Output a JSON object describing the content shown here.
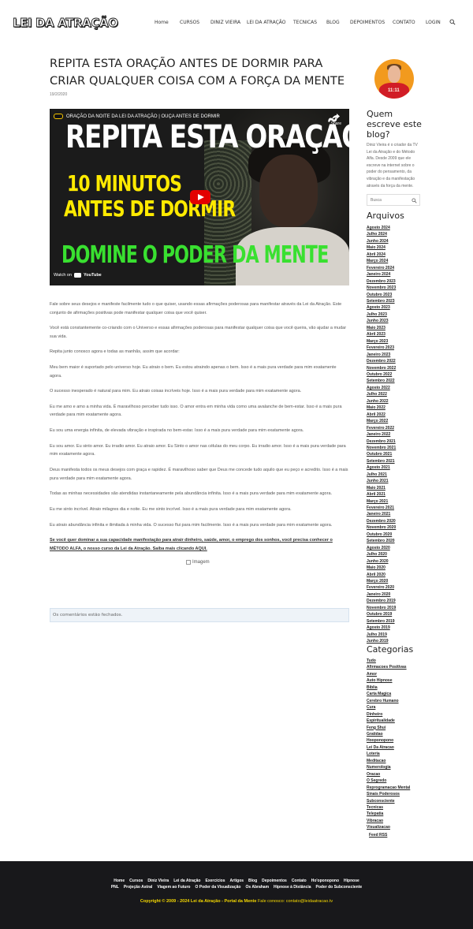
{
  "header": {
    "logo": "LEI DA ATRAÇÃO",
    "nav": [
      "Home",
      "CURSOS",
      "DINIZ VIEIRA",
      "LEI DA ATRAÇÃO",
      "TECNICAS",
      "BLOG",
      "DEPOIMENTOS",
      "CONTATO",
      "LOGIN"
    ],
    "search_icon": "search-icon"
  },
  "post": {
    "title": "REPITA ESTA ORAÇÃO ANTES DE DORMIR PARA CRIAR QUALQUER COISA COM A FORÇA DA MENTE",
    "date": "19/2/2020",
    "video": {
      "bar_title": "ORAÇÃO DA NOITE DA LEI DA ATRAÇÃO | OUÇA ANTES DE DORMIR",
      "share": "Share",
      "line1": "REPITA ESTA ORAÇÃO",
      "line2": "10 MINUTOS",
      "line3": "ANTES DE DORMIR",
      "line4": "DOMINE O PODER DA MENTE",
      "watch_on": "Watch on",
      "youtube": "YouTube"
    },
    "paragraphs": [
      "Fale sobre seus desejos e manifeste facilmente tudo o que quiser, usando essas afirmações poderosas para manifestar através da Lei da Atração. Este conjunto de afirmações positivas pode manifestar qualquer coisa que você quiser.",
      "Você está constantemente co-criando com o Universo e essas afirmações poderosas para manifestar qualquer coisa que você queira, vão ajudar a mudar sua vida.",
      "Repita junto conosco agora e todas as manhãs, assim que acordar:",
      "Meu bem maior é suportado pelo universo hoje. Eu atraio o bem. Eu estou atraindo apenas o bem. Isso é a mais pura verdade para mim exatamente agora.",
      "O sucesso inesperado é natural para mim. Eu atraio coisas incríveis hoje. Isso é a mais pura verdade para mim exatamente agora.",
      "Eu me amo e amo a minha vida. É maravilhoso perceber tudo isso. O amor entra em minha vida como uma avalanche de bem-estar. Isso é a mais pura verdade para mim exatamente agora.",
      "Eu sou uma energia infinita, de elevada vibração e inspirada no bem-estar. Isso é a mais pura verdade para mim exatamente agora.",
      "Eu sou amor. Eu sinto amor. Eu irradio amor. Eu atraio amor. Eu Sinto o amor nas células do meu corpo. Eu irradio amor. Isso é a mais pura verdade para mim exatamente agora.",
      "Deus manifesta todos os meus desejos com graça e rapidez. É maravilhoso saber que Deus me concede tudo aquilo que eu peço e acredito. Isso é a mais pura verdade para mim exatamente agora.",
      "Todas as minhas necessidades são atendidas instantaneamente pela abundância infinita. Isso é a mais pura verdade para mim exatamente agora.",
      "Eu me sinto incrível. Atraio milagres dia e noite. Eu me sinto incrível. Isso é a mais pura verdade para mim exatamente agora.",
      "Eu atraio abundância infinita e ilimitada à minha vida. O sucesso flui para mim facilmente. Isso é a mais pura verdade para mim exatamente agora."
    ],
    "cta": "Se você quer dominar a sua capacidade manifestação para atrair dinheiro, saúde, amor, o emprego dos sonhos, você precisa conhecer o MÉTODO ALFA, o nosso curso da Lei da Atração. Saiba mais clicando AQUI.",
    "image_alt": "Imagem",
    "comments_closed": "Os comentários estão fechados."
  },
  "sidebar": {
    "who_title": "Quem escreve este blog?",
    "who_text": "Diniz Vieira é o criador da TV Lei da Atração e do Método Alfa. Desde 2009 que ele escreve na internet sobre o poder do pensamento, da vibração e da manifestação através da força da mente.",
    "avatar_number": "11:11",
    "search_placeholder": "Busca",
    "archives_title": "Arquivos",
    "archives": [
      "Agosto 2024",
      "Julho 2024",
      "Junho 2024",
      "Maio 2024",
      "Abril 2024",
      "Março 2024",
      "Fevereiro 2024",
      "Janeiro 2024",
      "Dezembro 2023",
      "Novembro 2023",
      "Outubro 2023",
      "Setembro 2023",
      "Agosto 2023",
      "Julho 2023",
      "Junho 2023",
      "Maio 2023",
      "Abril 2023",
      "Março 2023",
      "Fevereiro 2023",
      "Janeiro 2023",
      "Dezembro 2022",
      "Novembro 2022",
      "Outubro 2022",
      "Setembro 2022",
      "Agosto 2022",
      "Julho 2022",
      "Junho 2022",
      "Maio 2022",
      "Abril 2022",
      "Março 2022",
      "Fevereiro 2022",
      "Janeiro 2022",
      "Dezembro 2021",
      "Novembro 2021",
      "Outubro 2021",
      "Setembro 2021",
      "Agosto 2021",
      "Julho 2021",
      "Junho 2021",
      "Maio 2021",
      "Abril 2021",
      "Março 2021",
      "Fevereiro 2021",
      "Janeiro 2021",
      "Dezembro 2020",
      "Novembro 2020",
      "Outubro 2020",
      "Setembro 2020",
      "Agosto 2020",
      "Julho 2020",
      "Junho 2020",
      "Maio 2020",
      "Abril 2020",
      "Março 2020",
      "Fevereiro 2020",
      "Janeiro 2020",
      "Dezembro 2019",
      "Novembro 2019",
      "Outubro 2019",
      "Setembro 2019",
      "Agosto 2019",
      "Julho 2019",
      "Junho 2019"
    ],
    "categories_title": "Categorias",
    "categories": [
      "Tudo",
      "Afirmacoes Positivas",
      "Amor",
      "Auto Hipnose",
      "Biblia",
      "Carta Magica",
      "Cerebro Humano",
      "Cura",
      "Dinheiro",
      "Espiritualidade",
      "Feng Shui",
      "Gratidao",
      "Hooponopono",
      "Lei Da Atracao",
      "Loteria",
      "Meditacao",
      "Numerologia",
      "Oracao",
      "O Segredo",
      "Reprogramacao Mental",
      "Sinais Poderosos",
      "Subconsciente",
      "Tecnicas",
      "Telepatia",
      "Vibracao",
      "Visualizacao"
    ],
    "feed": "Feed RSS"
  },
  "footer": {
    "row1": [
      "Home",
      "Cursos",
      "Diniz Vieira",
      "Lei da Atração",
      "Exercícios",
      "Artigos",
      "Blog",
      "Depoimentos",
      "Contato",
      "Ho'oponopono",
      "Hipnose"
    ],
    "row2": [
      "PNL",
      "Projeção Astral",
      "Viagem ao Futuro",
      "O Poder da Visualização",
      "Os Abraham",
      "Hipnose à Distância",
      "Poder do Subconsciente"
    ],
    "copyright": "Copyright © 2009 - 2024 Lei da Atração - Portal da Mente",
    "contact": "Fale conosco: contato@leidaatracao.tv"
  },
  "colors": {
    "accent_yellow": "#f5d800",
    "footer_bg": "#18181b",
    "video_green": "#39e030",
    "youtube_red": "#e30000"
  }
}
